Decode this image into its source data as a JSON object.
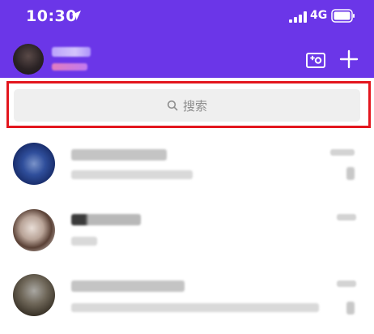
{
  "status_bar": {
    "time": "10:30",
    "carrier": "4G"
  },
  "header": {
    "me_name": "",
    "me_status": "",
    "video_icon": "video-camera-plus-icon",
    "add_icon": "plus-icon",
    "bg_color": "#6b36e8"
  },
  "search": {
    "placeholder": "搜索",
    "highlight_color": "#e3161e"
  },
  "chats": [
    {
      "name": "",
      "preview": "",
      "time": ""
    },
    {
      "name": "",
      "preview": "",
      "time": ""
    },
    {
      "name": "",
      "preview": "",
      "time": ""
    }
  ]
}
